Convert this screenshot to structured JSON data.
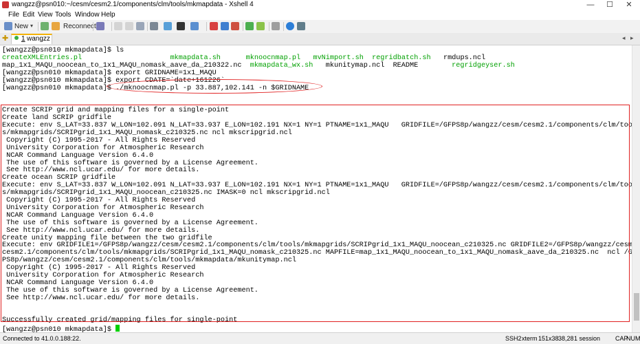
{
  "window": {
    "title": "wangzz@psn010:~/cesm/cesm2.1/components/clm/tools/mkmapdata - Xshell 4",
    "minimize": "—",
    "maximize": "☐",
    "close": "✕"
  },
  "menu": [
    "File",
    "Edit",
    "View",
    "Tools",
    "Window",
    "Help"
  ],
  "toolbar": {
    "new_label": "New",
    "reconnect_label": "Reconnect"
  },
  "tab": {
    "number": "1",
    "label": "wangzz"
  },
  "terminal": {
    "lines": [
      {
        "segs": [
          {
            "t": "[wangzz@psn010 mkmapdata]$ ls"
          }
        ]
      },
      {
        "segs": [
          {
            "t": "createXMLEntries.pl",
            "c": "grn"
          },
          {
            "t": "                     "
          },
          {
            "t": "mkmapdata.sh",
            "c": "grn"
          },
          {
            "t": "      "
          },
          {
            "t": "mknoocnmap.pl",
            "c": "grn"
          },
          {
            "t": "   "
          },
          {
            "t": "mvNimport.sh",
            "c": "grn"
          },
          {
            "t": "  "
          },
          {
            "t": "regridbatch.sh",
            "c": "grn"
          },
          {
            "t": "   rmdups.ncl"
          }
        ]
      },
      {
        "segs": [
          {
            "t": "map_1x1_MAQU_noocean_to_1x1_MAQU_nomask_aave_da_210322.nc  "
          },
          {
            "t": "mkmapdata_wx.sh",
            "c": "grn"
          },
          {
            "t": "   mkunitymap.ncl  README        "
          },
          {
            "t": "regridgeyser.sh",
            "c": "grn"
          }
        ]
      },
      {
        "segs": [
          {
            "t": "[wangzz@psn010 mkmapdata]$ export GRIDNAME=1x1_MAQU"
          }
        ]
      },
      {
        "segs": [
          {
            "t": "[wangzz@psn010 mkmapdata]$ export CDATE=`date+161226`"
          }
        ]
      },
      {
        "segs": [
          {
            "t": "[wangzz@psn010 mkmapdata]$ ./mknoocnmap.pl -p 33.887,102.141 -n $GRIDNAME"
          }
        ]
      },
      {
        "segs": [
          {
            "t": ""
          }
        ]
      },
      {
        "segs": [
          {
            "t": ""
          }
        ]
      },
      {
        "segs": [
          {
            "t": "Create SCRIP grid and mapping files for a single-point"
          }
        ]
      },
      {
        "segs": [
          {
            "t": "Create land SCRIP gridfile"
          }
        ]
      },
      {
        "segs": [
          {
            "t": "Execute: env S_LAT=33.837 W_LON=102.091 N_LAT=33.937 E_LON=102.191 NX=1 NY=1 PTNAME=1x1_MAQU   GRIDFILE=/GFPS8p/wangzz/cesm/cesm2.1/components/clm/tool"
          }
        ]
      },
      {
        "segs": [
          {
            "t": "s/mkmapgrids/SCRIPgrid_1x1_MAQU_nomask_c210325.nc ncl mkscripgrid.ncl"
          }
        ]
      },
      {
        "segs": [
          {
            "t": " Copyright (C) 1995-2017 - All Rights Reserved"
          }
        ]
      },
      {
        "segs": [
          {
            "t": " University Corporation for Atmospheric Research"
          }
        ]
      },
      {
        "segs": [
          {
            "t": " NCAR Command Language Version 6.4.0"
          }
        ]
      },
      {
        "segs": [
          {
            "t": " The use of this software is governed by a License Agreement."
          }
        ]
      },
      {
        "segs": [
          {
            "t": " See http://www.ncl.ucar.edu/ for more details."
          }
        ]
      },
      {
        "segs": [
          {
            "t": "Create ocean SCRIP gridfile"
          }
        ]
      },
      {
        "segs": [
          {
            "t": "Execute: env S_LAT=33.837 W_LON=102.091 N_LAT=33.937 E_LON=102.191 NX=1 NY=1 PTNAME=1x1_MAQU   GRIDFILE=/GFPS8p/wangzz/cesm/cesm2.1/components/clm/tool"
          }
        ]
      },
      {
        "segs": [
          {
            "t": "s/mkmapgrids/SCRIPgrid_1x1_MAQU_noocean_c210325.nc IMASK=0 ncl mkscripgrid.ncl"
          }
        ]
      },
      {
        "segs": [
          {
            "t": " Copyright (C) 1995-2017 - All Rights Reserved"
          }
        ]
      },
      {
        "segs": [
          {
            "t": " University Corporation for Atmospheric Research"
          }
        ]
      },
      {
        "segs": [
          {
            "t": " NCAR Command Language Version 6.4.0"
          }
        ]
      },
      {
        "segs": [
          {
            "t": " The use of this software is governed by a License Agreement."
          }
        ]
      },
      {
        "segs": [
          {
            "t": " See http://www.ncl.ucar.edu/ for more details."
          }
        ]
      },
      {
        "segs": [
          {
            "t": "Create unity mapping file between the two gridfile"
          }
        ]
      },
      {
        "segs": [
          {
            "t": "Execute: env GRIDFILE1=/GFPS8p/wangzz/cesm/cesm2.1/components/clm/tools/mkmapgrids/SCRIPgrid_1x1_MAQU_noocean_c210325.nc GRIDFILE2=/GFPS8p/wangzz/cesm/"
          }
        ]
      },
      {
        "segs": [
          {
            "t": "cesm2.1/components/clm/tools/mkmapgrids/SCRIPgrid_1x1_MAQU_nomask_c210325.nc MAPFILE=map_1x1_MAQU_noocean_to_1x1_MAQU_nomask_aave_da_210325.nc  ncl /GF"
          }
        ]
      },
      {
        "segs": [
          {
            "t": "PS8p/wangzz/cesm/cesm2.1/components/clm/tools/mkmapdata/mkunitymap.ncl"
          }
        ]
      },
      {
        "segs": [
          {
            "t": " Copyright (C) 1995-2017 - All Rights Reserved"
          }
        ]
      },
      {
        "segs": [
          {
            "t": " University Corporation for Atmospheric Research"
          }
        ]
      },
      {
        "segs": [
          {
            "t": " NCAR Command Language Version 6.4.0"
          }
        ]
      },
      {
        "segs": [
          {
            "t": " The use of this software is governed by a License Agreement."
          }
        ]
      },
      {
        "segs": [
          {
            "t": " See http://www.ncl.ucar.edu/ for more details."
          }
        ]
      },
      {
        "segs": [
          {
            "t": ""
          }
        ]
      },
      {
        "segs": [
          {
            "t": ""
          }
        ]
      },
      {
        "segs": [
          {
            "t": "Successfully created grid/mapping files for single-point"
          }
        ]
      },
      {
        "segs": [
          {
            "t": "[wangzz@psn010 mkmapdata]$ "
          }
        ],
        "cursor": true
      }
    ]
  },
  "status": {
    "connection": "Connected to 41.0.0.188:22.",
    "protocol": "SSH2",
    "term": "xterm",
    "size": "151x38",
    "cursor_pos": "38,28",
    "sessions": "1 session",
    "caps": "CAP",
    "num": "NUM"
  },
  "colors": {
    "highlight": "#e02020",
    "prompt_green": "#00a000",
    "tab_accent": "#f5b400"
  }
}
